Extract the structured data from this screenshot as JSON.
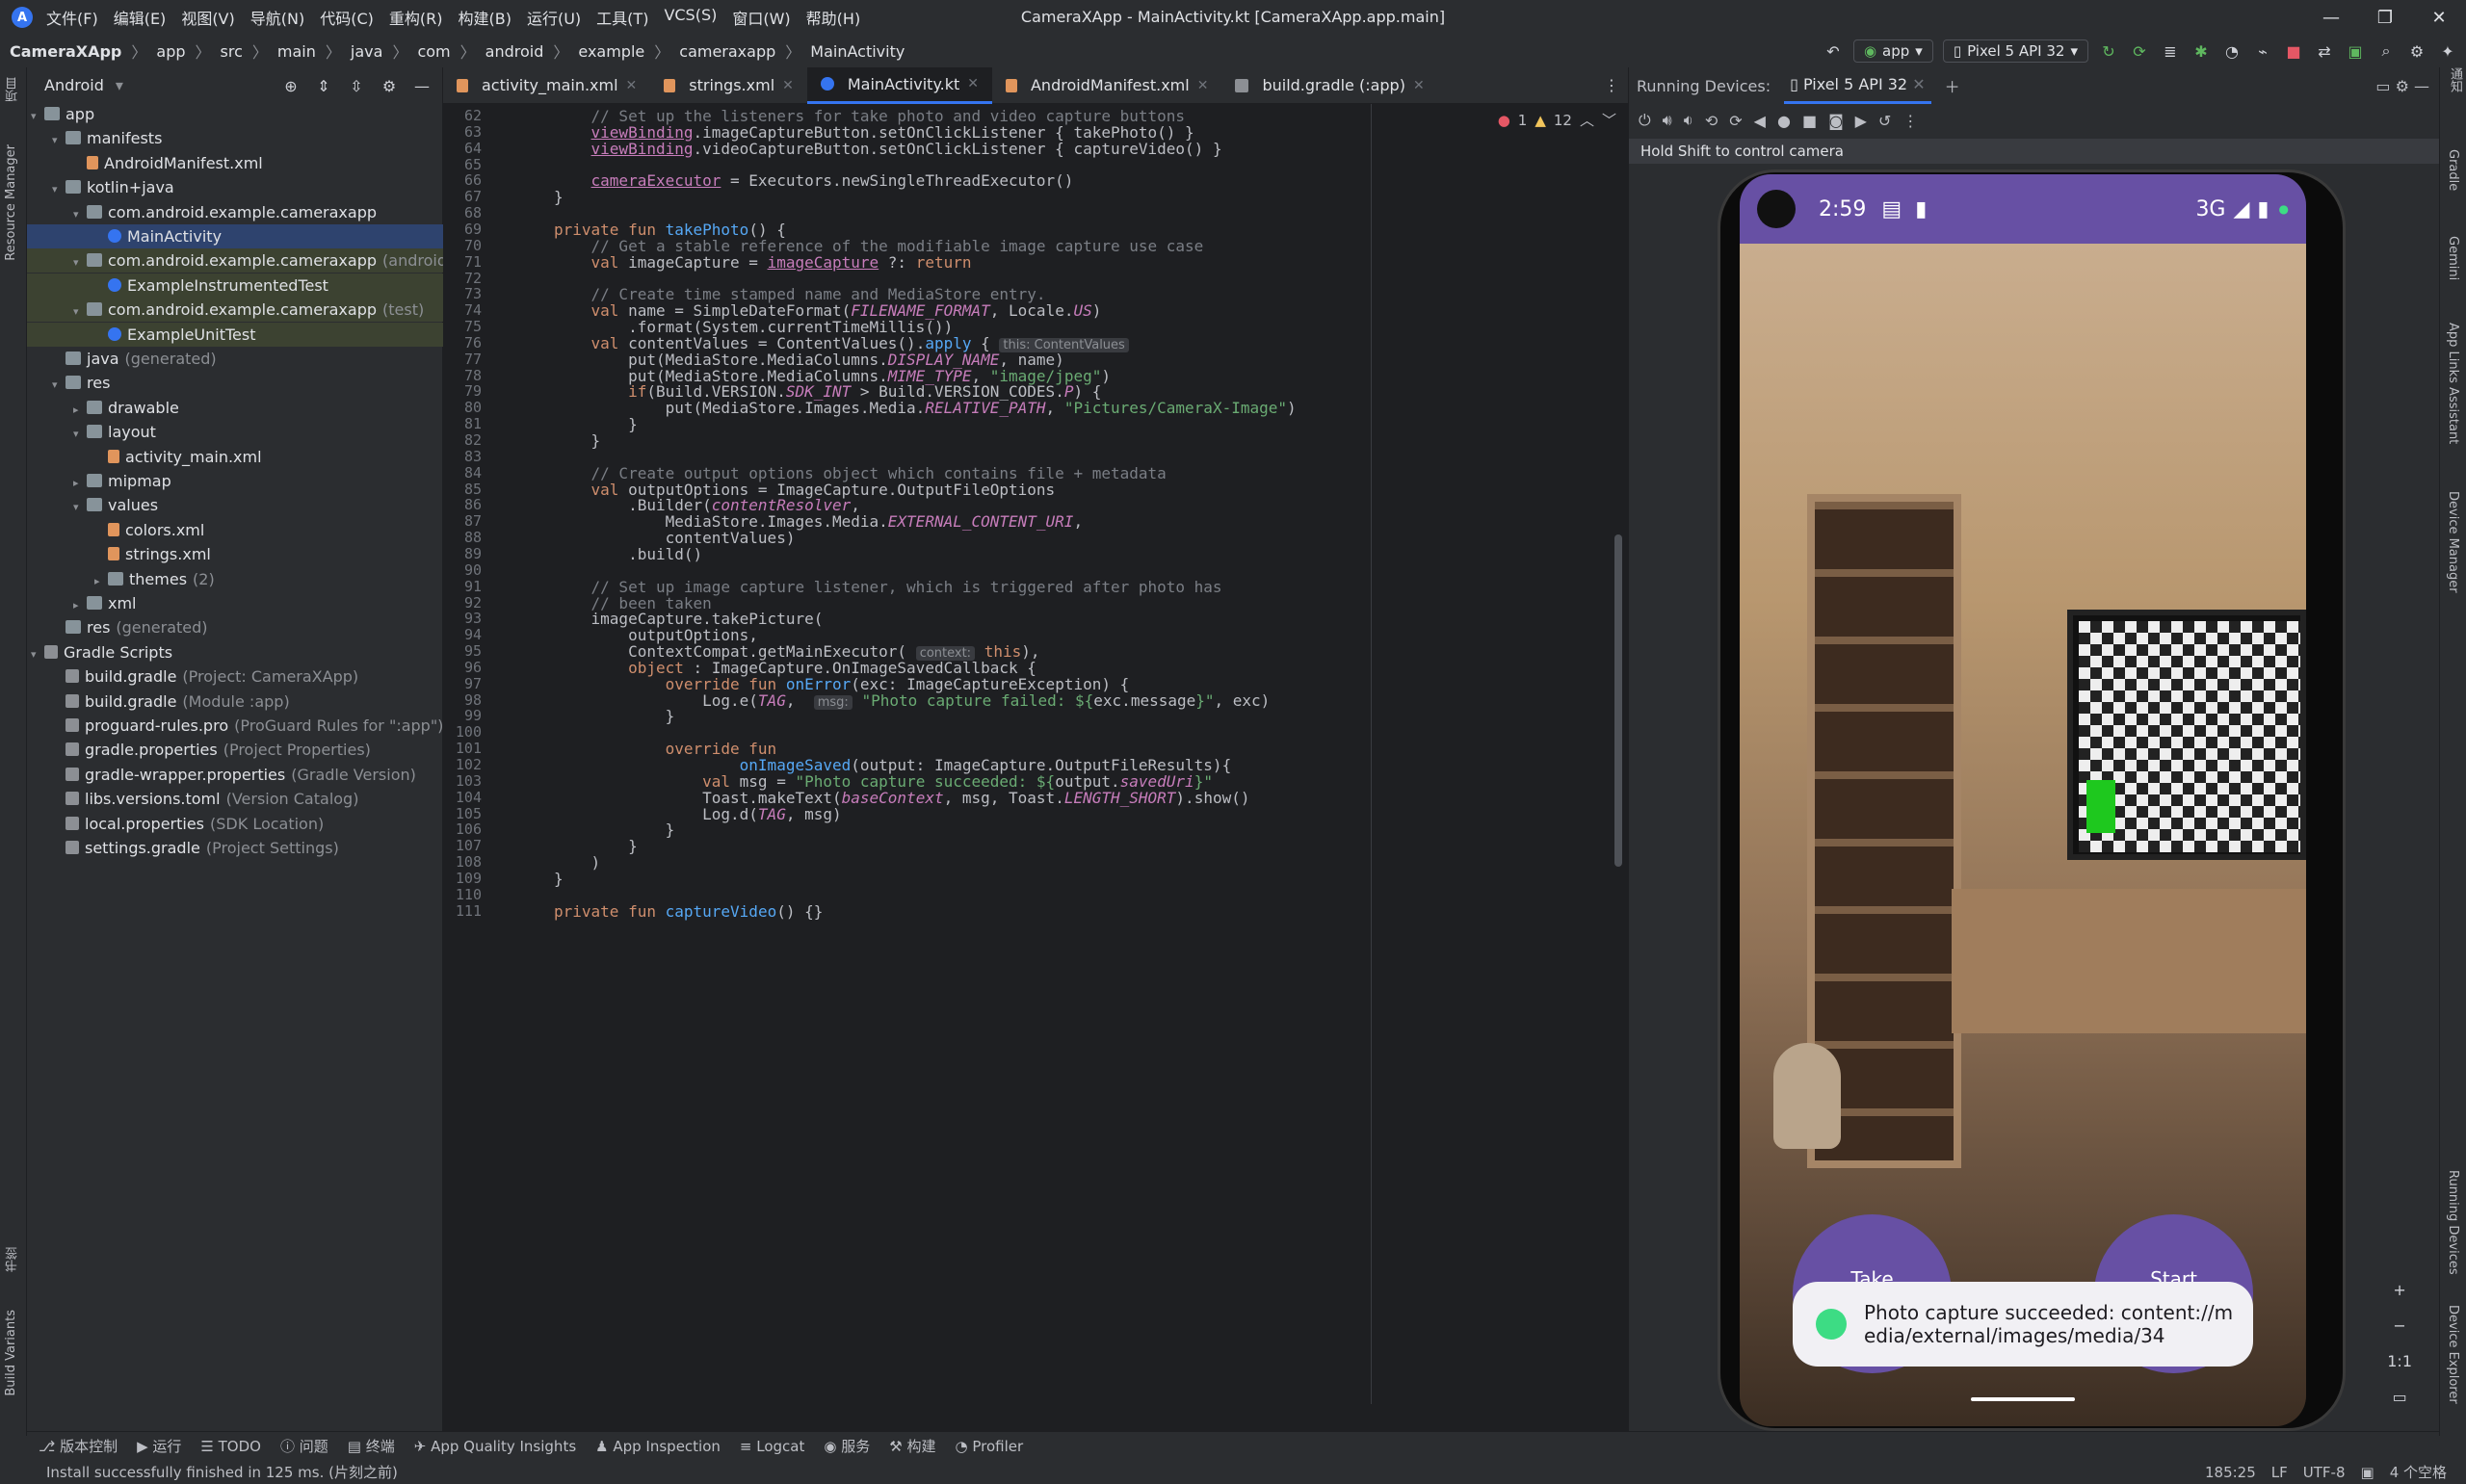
{
  "titlebar": {
    "menus": [
      "文件(F)",
      "编辑(E)",
      "视图(V)",
      "导航(N)",
      "代码(C)",
      "重构(R)",
      "构建(B)",
      "运行(U)",
      "工具(T)",
      "VCS(S)",
      "窗口(W)",
      "帮助(H)"
    ],
    "title": "CameraXApp - MainActivity.kt [CameraXApp.app.main]"
  },
  "navbar": {
    "crumbs": [
      "CameraXApp",
      "app",
      "src",
      "main",
      "java",
      "com",
      "android",
      "example",
      "cameraxapp",
      "MainActivity"
    ],
    "run_config": "app",
    "device": "Pixel 5 API 32"
  },
  "project": {
    "view": "Android",
    "tree": [
      {
        "label": "app",
        "hint": "",
        "indent": 0,
        "arrow": "▾",
        "icon": "folder"
      },
      {
        "label": "manifests",
        "hint": "",
        "indent": 1,
        "arrow": "▾",
        "icon": "folder"
      },
      {
        "label": "AndroidManifest.xml",
        "hint": "",
        "indent": 2,
        "arrow": "",
        "icon": "xmlf"
      },
      {
        "label": "kotlin+java",
        "hint": "",
        "indent": 1,
        "arrow": "▾",
        "icon": "folder"
      },
      {
        "label": "com.android.example.cameraxapp",
        "hint": "",
        "indent": 2,
        "arrow": "▾",
        "icon": "folder"
      },
      {
        "label": "MainActivity",
        "hint": "",
        "indent": 3,
        "arrow": "",
        "icon": "kt",
        "selected": true
      },
      {
        "label": "com.android.example.cameraxapp",
        "hint": "(androidTe",
        "indent": 2,
        "arrow": "▾",
        "icon": "folder"
      },
      {
        "label": "ExampleInstrumentedTest",
        "hint": "",
        "indent": 3,
        "arrow": "",
        "icon": "kt"
      },
      {
        "label": "com.android.example.cameraxapp",
        "hint": "(test)",
        "indent": 2,
        "arrow": "▾",
        "icon": "folder"
      },
      {
        "label": "ExampleUnitTest",
        "hint": "",
        "indent": 3,
        "arrow": "",
        "icon": "kt"
      },
      {
        "label": "java",
        "hint": "(generated)",
        "indent": 1,
        "arrow": "",
        "icon": "folder"
      },
      {
        "label": "res",
        "hint": "",
        "indent": 1,
        "arrow": "▾",
        "icon": "folder"
      },
      {
        "label": "drawable",
        "hint": "",
        "indent": 2,
        "arrow": "▸",
        "icon": "folder"
      },
      {
        "label": "layout",
        "hint": "",
        "indent": 2,
        "arrow": "▾",
        "icon": "folder"
      },
      {
        "label": "activity_main.xml",
        "hint": "",
        "indent": 3,
        "arrow": "",
        "icon": "xmlf"
      },
      {
        "label": "mipmap",
        "hint": "",
        "indent": 2,
        "arrow": "▸",
        "icon": "folder"
      },
      {
        "label": "values",
        "hint": "",
        "indent": 2,
        "arrow": "▾",
        "icon": "folder"
      },
      {
        "label": "colors.xml",
        "hint": "",
        "indent": 3,
        "arrow": "",
        "icon": "xmlf"
      },
      {
        "label": "strings.xml",
        "hint": "",
        "indent": 3,
        "arrow": "",
        "icon": "xmlf"
      },
      {
        "label": "themes",
        "hint": "(2)",
        "indent": 3,
        "arrow": "▸",
        "icon": "folder"
      },
      {
        "label": "xml",
        "hint": "",
        "indent": 2,
        "arrow": "▸",
        "icon": "folder"
      },
      {
        "label": "res",
        "hint": "(generated)",
        "indent": 1,
        "arrow": "",
        "icon": "folder"
      },
      {
        "label": "Gradle Scripts",
        "hint": "",
        "indent": 0,
        "arrow": "▾",
        "icon": "gradle"
      },
      {
        "label": "build.gradle",
        "hint": "(Project: CameraXApp)",
        "indent": 1,
        "arrow": "",
        "icon": "gradle"
      },
      {
        "label": "build.gradle",
        "hint": "(Module :app)",
        "indent": 1,
        "arrow": "",
        "icon": "gradle"
      },
      {
        "label": "proguard-rules.pro",
        "hint": "(ProGuard Rules for \":app\")",
        "indent": 1,
        "arrow": "",
        "icon": "gradle"
      },
      {
        "label": "gradle.properties",
        "hint": "(Project Properties)",
        "indent": 1,
        "arrow": "",
        "icon": "gradle"
      },
      {
        "label": "gradle-wrapper.properties",
        "hint": "(Gradle Version)",
        "indent": 1,
        "arrow": "",
        "icon": "gradle"
      },
      {
        "label": "libs.versions.toml",
        "hint": "(Version Catalog)",
        "indent": 1,
        "arrow": "",
        "icon": "gradle"
      },
      {
        "label": "local.properties",
        "hint": "(SDK Location)",
        "indent": 1,
        "arrow": "",
        "icon": "gradle"
      },
      {
        "label": "settings.gradle",
        "hint": "(Project Settings)",
        "indent": 1,
        "arrow": "",
        "icon": "gradle"
      }
    ]
  },
  "editor": {
    "tabs": [
      {
        "label": "activity_main.xml",
        "active": false
      },
      {
        "label": "strings.xml",
        "active": false
      },
      {
        "label": "MainActivity.kt",
        "active": true
      },
      {
        "label": "AndroidManifest.xml",
        "active": false
      },
      {
        "label": "build.gradle (:app)",
        "active": false
      }
    ],
    "inspections": {
      "errors": "1",
      "warnings": "12"
    },
    "first_line": 62,
    "lines": [
      "    <span class=\"cm\">// Set up the listeners for take photo and video capture buttons</span>",
      "    <span class=\"ul\">viewBinding</span>.imageCaptureButton.setOnClickListener { takePhoto() }",
      "    <span class=\"ul\">viewBinding</span>.videoCaptureButton.setOnClickListener { captureVideo() }",
      "",
      "    <span class=\"ul\">cameraExecutor</span> = Executors.newSingleThreadExecutor()",
      "}",
      "",
      "<span class=\"kw\">private fun</span> <span class=\"fn\">takePhoto</span>() {",
      "    <span class=\"cm\">// Get a stable reference of the modifiable image capture use case</span>",
      "    <span class=\"kw\">val</span> imageCapture = <span class=\"ul\">imageCapture</span> ?: <span class=\"kw\">return</span>",
      "",
      "    <span class=\"cm\">// Create time stamped name and MediaStore entry.</span>",
      "    <span class=\"kw\">val</span> name = SimpleDateFormat(<span class=\"it\">FILENAME_FORMAT</span>, Locale.<span class=\"it\">US</span>)",
      "        .format(System.currentTimeMillis())",
      "    <span class=\"kw\">val</span> contentValues = ContentValues().<span class=\"fn\">apply</span> { <span class=\"ih\">this: ContentValues</span>",
      "        put(MediaStore.MediaColumns.<span class=\"it\">DISPLAY_NAME</span>, name)",
      "        put(MediaStore.MediaColumns.<span class=\"it\">MIME_TYPE</span>, <span class=\"st\">\"image/jpeg\"</span>)",
      "        <span class=\"kw\">if</span>(Build.VERSION.<span class=\"it\">SDK_INT</span> &gt; Build.VERSION_CODES.<span class=\"it\">P</span>) {",
      "            put(MediaStore.Images.Media.<span class=\"it\">RELATIVE_PATH</span>, <span class=\"st\">\"Pictures/CameraX-Image\"</span>)",
      "        }",
      "    }",
      "",
      "    <span class=\"cm\">// Create output options object which contains file + metadata</span>",
      "    <span class=\"kw\">val</span> outputOptions = ImageCapture.OutputFileOptions",
      "        .Builder(<span class=\"it\">contentResolver</span>,",
      "            MediaStore.Images.Media.<span class=\"it\">EXTERNAL_CONTENT_URI</span>,",
      "            contentValues)",
      "        .build()",
      "",
      "    <span class=\"cm\">// Set up image capture listener, which is triggered after photo has</span>",
      "    <span class=\"cm\">// been taken</span>",
      "    imageCapture.takePicture(",
      "        outputOptions,",
      "        ContextCompat.getMainExecutor( <span class=\"ih\">context:</span> <span class=\"kw\">this</span>),",
      "        <span class=\"kw\">object</span> : ImageCapture.OnImageSavedCallback {",
      "            <span class=\"kw\">override fun</span> <span class=\"fn\">onError</span>(exc: ImageCaptureException) {",
      "                Log.e(<span class=\"it\">TAG</span>,  <span class=\"ih\">msg:</span> <span class=\"st\">\"Photo capture failed: ${</span>exc.message<span class=\"st\">}\"</span>, exc)",
      "            }",
      "",
      "            <span class=\"kw\">override fun</span>",
      "                    <span class=\"fn\">onImageSaved</span>(output: ImageCapture.OutputFileResults){",
      "                <span class=\"kw\">val</span> msg = <span class=\"st\">\"Photo capture succeeded: ${</span>output.<span class=\"it\">savedUri</span><span class=\"st\">}\"</span>",
      "                Toast.makeText(<span class=\"it\">baseContext</span>, msg, Toast.<span class=\"it\">LENGTH_SHORT</span>).show()",
      "                Log.d(<span class=\"it\">TAG</span>, msg)",
      "            }",
      "        }",
      "    )",
      "}",
      "",
      "<span class=\"kw\">private fun</span> <span class=\"fn\">captureVideo</span>() {}"
    ]
  },
  "devices": {
    "label": "Running Devices:",
    "tab": "Pixel 5 API 32",
    "hint": "Hold Shift to control camera",
    "phone": {
      "time": "2:59",
      "network": "3G",
      "take_label": "Take",
      "start_label": "Start",
      "toast": "Photo capture succeeded: content://media/external/images/media/34"
    },
    "zoom": {
      "plus": "+",
      "minus": "−",
      "ratio": "1:1"
    }
  },
  "leftstrip": {
    "top": "项目",
    "resource": "Resource Manager",
    "bookmarks": "书签",
    "build_variants": "Build Variants"
  },
  "rightstrip": {
    "notifications": "通知",
    "gradle": "Gradle",
    "gemini": "Gemini",
    "app_links": "App Links Assistant",
    "device_manager": "Device Manager",
    "running_devices": "Running Devices",
    "device_explorer": "Device Explorer"
  },
  "toolwindows": [
    "版本控制",
    "运行",
    "TODO",
    "问题",
    "终端",
    "App Quality Insights",
    "App Inspection",
    "Logcat",
    "服务",
    "构建",
    "Profiler"
  ],
  "status": {
    "message": "Install successfully finished in 125 ms. (片刻之前)",
    "position": "185:25",
    "line_sep": "LF",
    "encoding": "UTF-8",
    "indent": "4 个空格"
  }
}
